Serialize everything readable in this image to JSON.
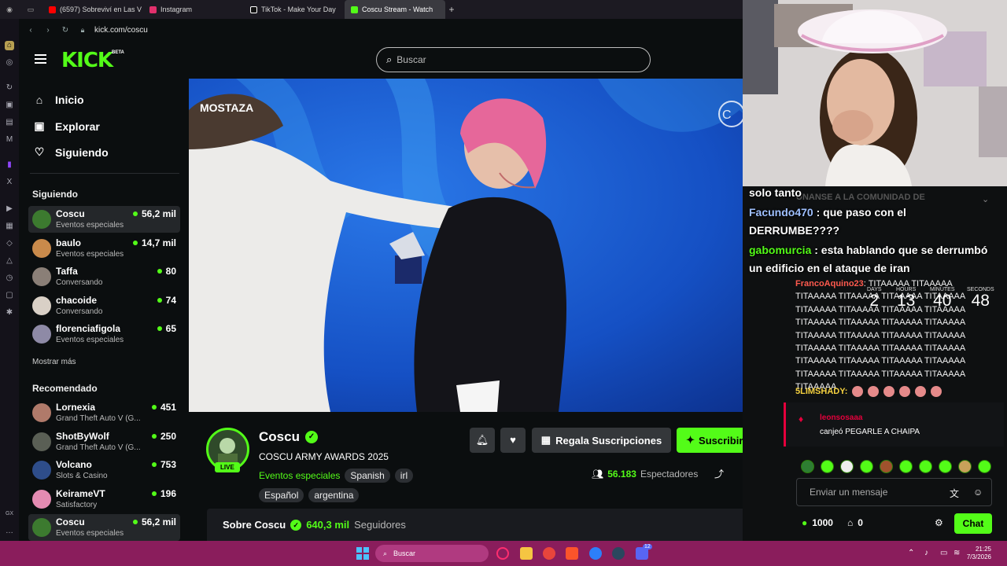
{
  "browser": {
    "tabs": [
      {
        "label": "(6597) Sobreviví en Las V",
        "color": "#ff0000"
      },
      {
        "label": "Instagram",
        "color": "#e1306c"
      },
      {
        "label": "TikTok - Make Your Day",
        "color": "#ffffff"
      },
      {
        "label": "Coscu Stream - Watch",
        "color": "#53fc18"
      }
    ],
    "url": "kick.com/coscu"
  },
  "header": {
    "logo": "KICK",
    "beta": "BETA",
    "search_placeholder": "Buscar"
  },
  "nav": {
    "main": [
      {
        "label": "Inicio",
        "icon": "home-icon"
      },
      {
        "label": "Explorar",
        "icon": "compass-icon"
      },
      {
        "label": "Siguiendo",
        "icon": "heart-icon"
      }
    ],
    "following_title": "Siguiendo",
    "following": [
      {
        "name": "Coscu",
        "category": "Eventos especiales",
        "viewers": "56,2 mil",
        "color": "#3c7a2f"
      },
      {
        "name": "baulo",
        "category": "Eventos especiales",
        "viewers": "14,7 mil",
        "color": "#c98a4b"
      },
      {
        "name": "Taffa",
        "category": "Conversando",
        "viewers": "80",
        "color": "#8a7f77"
      },
      {
        "name": "chacoide",
        "category": "Conversando",
        "viewers": "74",
        "color": "#d9d0c6"
      },
      {
        "name": "florenciafigola",
        "category": "Eventos especiales",
        "viewers": "65",
        "color": "#8e8aa6"
      }
    ],
    "show_more": "Mostrar más",
    "recommended_title": "Recomendado",
    "recommended": [
      {
        "name": "Lornexia",
        "category": "Grand Theft Auto V (G...",
        "viewers": "451",
        "color": "#b07a6a"
      },
      {
        "name": "ShotByWolf",
        "category": "Grand Theft Auto V (G...",
        "viewers": "250",
        "color": "#5a5f55"
      },
      {
        "name": "Volcano",
        "category": "Slots & Casino",
        "viewers": "753",
        "color": "#2e4d8a"
      },
      {
        "name": "KeirameVT",
        "category": "Satisfactory",
        "viewers": "196",
        "color": "#e48bb2"
      },
      {
        "name": "Coscu",
        "category": "Eventos especiales",
        "viewers": "56,2 mil",
        "color": "#3c7a2f"
      }
    ]
  },
  "video": {
    "overlay_logo": "MOSTAZA"
  },
  "stream": {
    "name": "Coscu",
    "live": "LIVE",
    "title": "COSCU ARMY AWARDS 2025",
    "category": "Eventos especiales",
    "tags_row1": [
      "Spanish",
      "irl"
    ],
    "tags_row2": [
      "Español",
      "argentina"
    ],
    "gift_label": "Regala Suscripciones",
    "subscribe_label": "Suscribirse",
    "viewers_count": "56.183",
    "viewers_label": "Espectadores",
    "about_label": "Sobre Coscu",
    "followers_count": "640,3 mil",
    "followers_label": "Seguidores"
  },
  "chat": {
    "ghost_text": "ÚNANSE A LA COMUNIDAD DE",
    "overlay_msgs": [
      {
        "user": "",
        "text": "solo  tanto"
      },
      {
        "user": "Facundo470",
        "text": ":  que paso con el"
      },
      {
        "user": "",
        "text": "DERRUMBE????"
      },
      {
        "user": "gabomurcia",
        "text": ": esta hablando que se derrumbó"
      },
      {
        "user": "",
        "text": "un edificio en el ataque de iran"
      }
    ],
    "countdown": [
      {
        "label": "DAYS",
        "value": "2"
      },
      {
        "label": "HOURS",
        "value": "13"
      },
      {
        "label": "MINUTES",
        "value": "40"
      },
      {
        "label": "SECONDS",
        "value": "48"
      }
    ],
    "tita_user": "FrancoAquino23",
    "tita_text": ": TITAAAAA TITAAAAA TITAAAAA TITAAAAA TITAAAAA TITAAAAA TITAAAAA TITAAAAA TITAAAAA TITAAAAA TITAAAAA TITAAAAA TITAAAAA TITAAAAA TITAAAAA TITAAAAA TITAAAAA TITAAAAA TITAAAAA TITAAAAA TITAAAAA TITAAAAA TITAAAAA TITAAAAA TITAAAAA TITAAAAA TITAAAAA TITAAAAA TITAAAAA TITAAAAA TITAAAAA",
    "slim_user": "5LIMSHADY:",
    "redeem_user": "leonsosaaa",
    "redeem_text": "canjeó PEGARLE A CHAIPA",
    "input_placeholder": "Enviar un mensaje",
    "points": "1000",
    "gifts": "0",
    "chat_button": "Chat"
  },
  "taskbar": {
    "search": "Buscar",
    "time": "21:25",
    "date": "7/3/2026",
    "badge": "12"
  }
}
